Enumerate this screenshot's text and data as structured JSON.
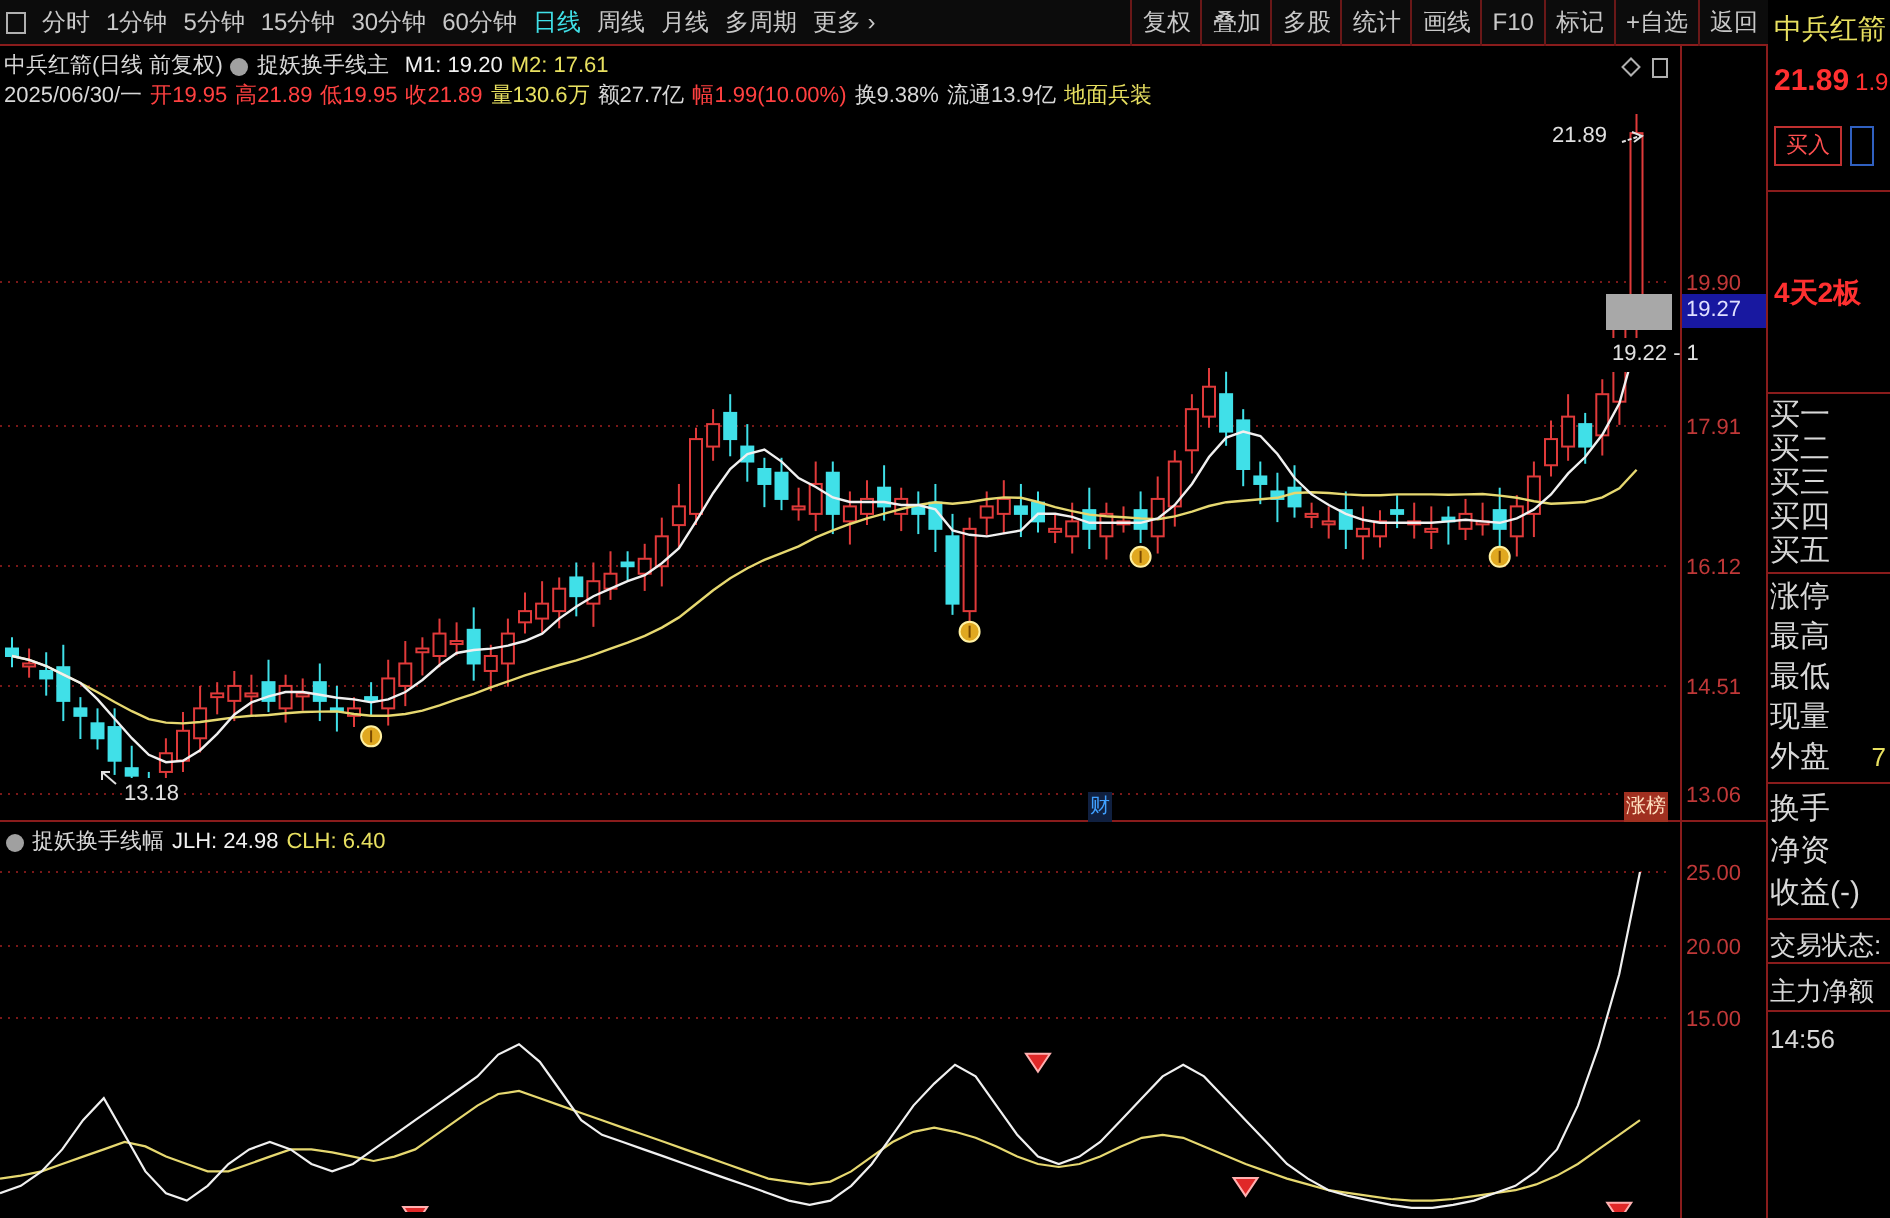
{
  "toolbar": {
    "periods": [
      {
        "label": "分时",
        "selected": false
      },
      {
        "label": "1分钟",
        "selected": false
      },
      {
        "label": "5分钟",
        "selected": false
      },
      {
        "label": "15分钟",
        "selected": false
      },
      {
        "label": "30分钟",
        "selected": false
      },
      {
        "label": "60分钟",
        "selected": false
      },
      {
        "label": "日线",
        "selected": true
      },
      {
        "label": "周线",
        "selected": false
      },
      {
        "label": "月线",
        "selected": false
      },
      {
        "label": "多周期",
        "selected": false
      },
      {
        "label": "更多 ›",
        "selected": false
      }
    ],
    "actions": [
      "复权",
      "叠加",
      "多股",
      "统计",
      "画线",
      "F10",
      "标记",
      "+自选",
      "返回"
    ]
  },
  "stock_header": {
    "title": "中兵红箭(日线 前复权)",
    "indicator": "捉妖换手线主",
    "m1": "M1: 19.20",
    "m2": "M2: 17.61"
  },
  "quote_line": [
    {
      "text": "2025/06/30/一",
      "kind": "neutral"
    },
    {
      "text": "开19.95",
      "kind": "up"
    },
    {
      "text": "高21.89",
      "kind": "up"
    },
    {
      "text": "低19.95",
      "kind": "up"
    },
    {
      "text": "收21.89",
      "kind": "up"
    },
    {
      "text": "量130.6万",
      "kind": "volume"
    },
    {
      "text": "额27.7亿",
      "kind": "neutral"
    },
    {
      "text": "幅1.99(10.00%)",
      "kind": "up"
    },
    {
      "text": "换9.38%",
      "kind": "neutral"
    },
    {
      "text": "流通13.9亿",
      "kind": "neutral"
    },
    {
      "text": "地面兵装",
      "kind": "volume"
    }
  ],
  "price_chart": {
    "axis_labels": [
      "19.90",
      "17.91",
      "16.12",
      "14.51",
      "13.06"
    ],
    "high_label": "21.89",
    "low_label": "13.18",
    "range_label": "19.22 - 1",
    "price_tag": "19.27",
    "finance_marker": "财",
    "rank_marker": "涨榜"
  },
  "indicator_panel": {
    "name": "捉妖换手线幅",
    "jlh": "JLH: 24.98",
    "clh": "CLH: 6.40",
    "axis_labels": [
      "25.00",
      "20.00",
      "15.00"
    ]
  },
  "side_panel": {
    "name": "中兵红箭",
    "price": "21.89",
    "change": "1.9",
    "buy_button": "买入",
    "streak": "4天2板",
    "bid_labels": [
      "买一",
      "买二",
      "买三",
      "买四",
      "买五"
    ],
    "stats": [
      "涨停",
      "最高",
      "最低",
      "现量",
      "外盘"
    ],
    "outer_value": "7",
    "finance": [
      "换手",
      "净资",
      "收益(-)"
    ],
    "status": "交易状态:",
    "main_net": "主力净额",
    "time": "14:56"
  }
}
